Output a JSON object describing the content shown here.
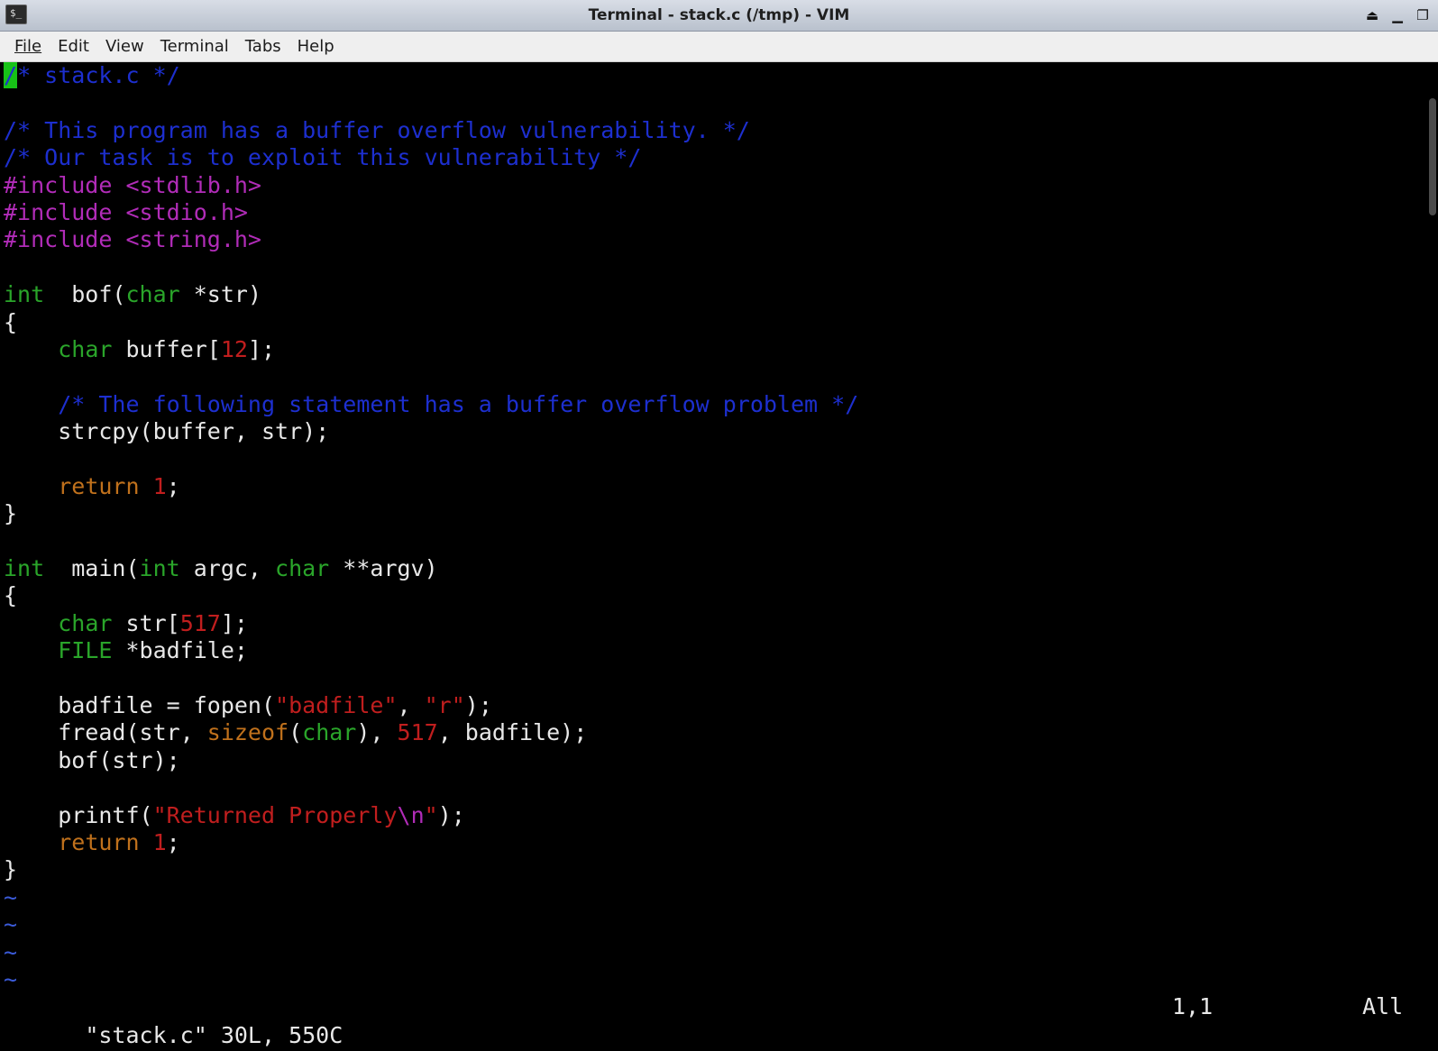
{
  "window": {
    "title": "Terminal - stack.c (/tmp) - VIM",
    "icon": "terminal-icon",
    "controls": [
      "eject-icon",
      "minimize-icon",
      "maximize-icon"
    ]
  },
  "menu": [
    "File",
    "Edit",
    "View",
    "Terminal",
    "Tabs",
    "Help"
  ],
  "editor": {
    "lines": [
      [
        [
          "cm",
          "/* stack.c */"
        ]
      ],
      [],
      [
        [
          "cm",
          "/* This program has a buffer overflow vulnerability. */"
        ]
      ],
      [
        [
          "cm",
          "/* Our task is to exploit this vulnerability */"
        ]
      ],
      [
        [
          "pp",
          "#include <stdlib.h>"
        ]
      ],
      [
        [
          "pp",
          "#include <stdio.h>"
        ]
      ],
      [
        [
          "pp",
          "#include <string.h>"
        ]
      ],
      [],
      [
        [
          "ty",
          "int"
        ],
        [
          "",
          "  bof("
        ],
        [
          "ty",
          "char"
        ],
        [
          "",
          " *str)"
        ]
      ],
      [
        [
          "",
          "{"
        ]
      ],
      [
        [
          "",
          "    "
        ],
        [
          "ty",
          "char"
        ],
        [
          "",
          " buffer["
        ],
        [
          "nm",
          "12"
        ],
        [
          "",
          "];"
        ]
      ],
      [],
      [
        [
          "",
          "    "
        ],
        [
          "cm",
          "/* The following statement has a buffer overflow problem */"
        ]
      ],
      [
        [
          "",
          "    strcpy(buffer, str);"
        ]
      ],
      [],
      [
        [
          "",
          "    "
        ],
        [
          "kw",
          "return"
        ],
        [
          "",
          " "
        ],
        [
          "nm",
          "1"
        ],
        [
          "",
          ";"
        ]
      ],
      [
        [
          "",
          "}"
        ]
      ],
      [],
      [
        [
          "ty",
          "int"
        ],
        [
          "",
          "  main("
        ],
        [
          "ty",
          "int"
        ],
        [
          "",
          " argc, "
        ],
        [
          "ty",
          "char"
        ],
        [
          "",
          " **argv)"
        ]
      ],
      [
        [
          "",
          "{"
        ]
      ],
      [
        [
          "",
          "    "
        ],
        [
          "ty",
          "char"
        ],
        [
          "",
          " str["
        ],
        [
          "nm",
          "517"
        ],
        [
          "",
          "];"
        ]
      ],
      [
        [
          "",
          "    "
        ],
        [
          "ty",
          "FILE"
        ],
        [
          "",
          " *badfile;"
        ]
      ],
      [],
      [
        [
          "",
          "    badfile = fopen("
        ],
        [
          "st",
          "\"badfile\""
        ],
        [
          "",
          ", "
        ],
        [
          "st",
          "\"r\""
        ],
        [
          "",
          ");"
        ]
      ],
      [
        [
          "",
          "    fread(str, "
        ],
        [
          "kw",
          "sizeof"
        ],
        [
          "",
          "("
        ],
        [
          "ty",
          "char"
        ],
        [
          "",
          "), "
        ],
        [
          "nm",
          "517"
        ],
        [
          "",
          ", badfile);"
        ]
      ],
      [
        [
          "",
          "    bof(str);"
        ]
      ],
      [],
      [
        [
          "",
          "    printf("
        ],
        [
          "st",
          "\"Returned Properly"
        ],
        [
          "sc",
          "\\n"
        ],
        [
          "st",
          "\""
        ],
        [
          "",
          ");"
        ]
      ],
      [
        [
          "",
          "    "
        ],
        [
          "kw",
          "return"
        ],
        [
          "",
          " "
        ],
        [
          "nm",
          "1"
        ],
        [
          "",
          ";"
        ]
      ],
      [
        [
          "",
          "}"
        ]
      ],
      [
        [
          "tl",
          "~"
        ]
      ],
      [
        [
          "tl",
          "~"
        ]
      ],
      [
        [
          "tl",
          "~"
        ]
      ],
      [
        [
          "tl",
          "~"
        ]
      ]
    ],
    "status": {
      "message": "\"stack.c\" 30L, 550C",
      "position": "1,1",
      "scroll": "All"
    }
  },
  "colors": {
    "comment": "#1d2fcf",
    "preproc": "#b12cb8",
    "type": "#2aa52a",
    "string": "#c01e1e",
    "keyword": "#c0711c",
    "cursor": "#17c217"
  }
}
